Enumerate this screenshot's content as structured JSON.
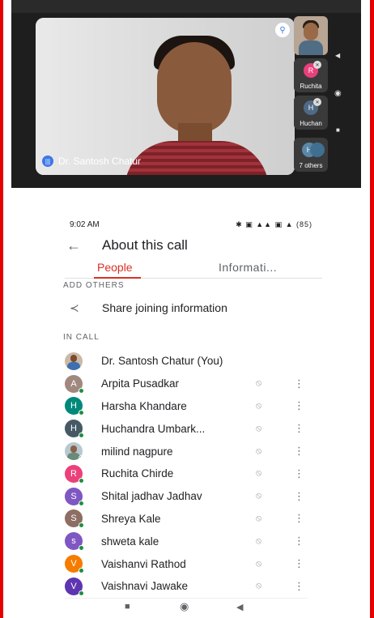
{
  "video": {
    "main_speaker": "Dr. Santosh Chatur",
    "tiles": [
      {
        "label": "",
        "initial": ""
      },
      {
        "label": "Ruchita",
        "initial": "R",
        "color": "#e8407a"
      },
      {
        "label": "Huchan",
        "initial": "H",
        "color": "#4f6a86"
      },
      {
        "label": "7 others",
        "initial": "H"
      }
    ]
  },
  "status": {
    "time": "9:02 AM",
    "icons": "✱ ▣ ▲▲ ▣ ▲ (85)"
  },
  "header": {
    "title": "About this call"
  },
  "tabs": [
    {
      "label": "People"
    },
    {
      "label": "Informati..."
    }
  ],
  "sections": {
    "add_others": "ADD OTHERS",
    "in_call": "IN CALL"
  },
  "share": {
    "label": "Share joining information"
  },
  "participants": [
    {
      "name": "Dr. Santosh Chatur (You)",
      "initial": "",
      "color": "",
      "photo": true
    },
    {
      "name": "Arpita Pusadkar",
      "initial": "A",
      "color": "#a1887f"
    },
    {
      "name": "Harsha Khandare",
      "initial": "H",
      "color": "#00897b"
    },
    {
      "name": "Huchandra Umbark...",
      "initial": "H",
      "color": "#455a64"
    },
    {
      "name": "milind nagpure",
      "initial": "",
      "color": "",
      "photo": true
    },
    {
      "name": "Ruchita Chirde",
      "initial": "R",
      "color": "#ec407a"
    },
    {
      "name": "Shital jadhav Jadhav",
      "initial": "S",
      "color": "#7e57c2"
    },
    {
      "name": "Shreya Kale",
      "initial": "S",
      "color": "#8d6e63"
    },
    {
      "name": "shweta kale",
      "initial": "s",
      "color": "#7e57c2"
    },
    {
      "name": "Vaishanvi Rathod",
      "initial": "V",
      "color": "#f57c00"
    },
    {
      "name": "Vaishnavi Jawake",
      "initial": "V",
      "color": "#5e35b1"
    }
  ]
}
